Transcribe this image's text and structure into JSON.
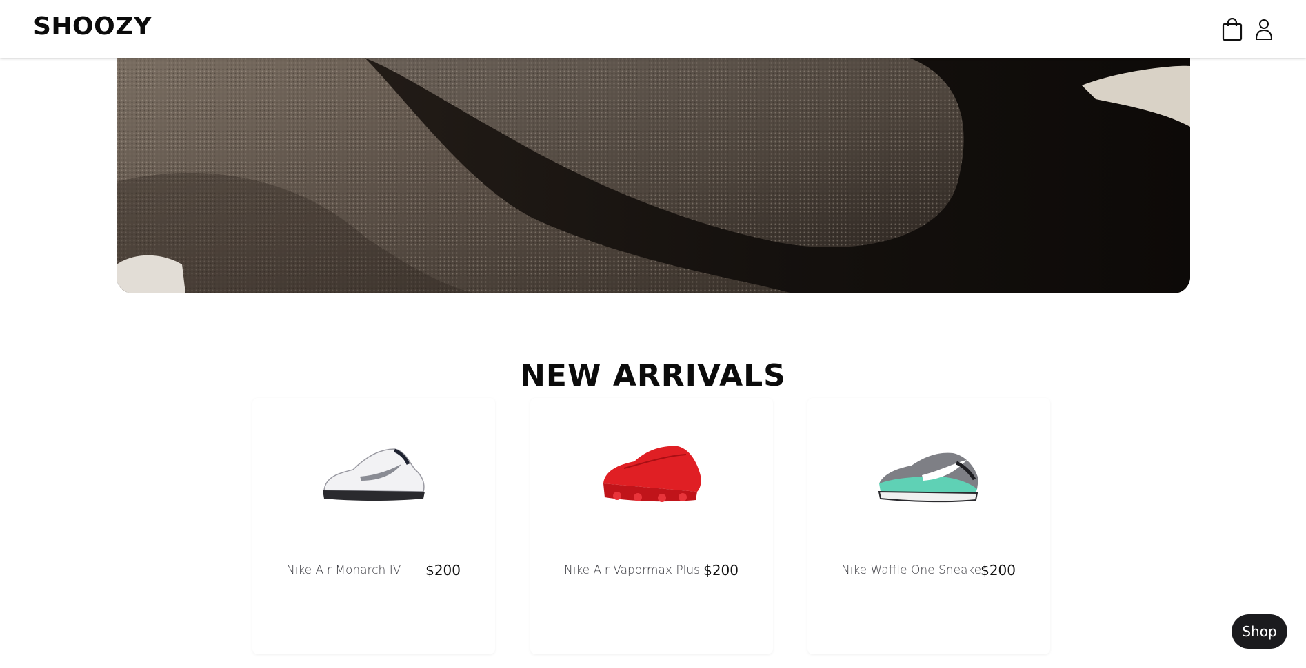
{
  "brand": {
    "logo_text": "SHOOZY"
  },
  "header": {
    "icons": [
      "shopping-bag-icon",
      "user-icon"
    ]
  },
  "hero": {
    "image": "knit-sneaker-closeup"
  },
  "new_arrivals": {
    "title": "NEW ARRIVALS",
    "products": [
      {
        "name": "Nike Air Monarch IV",
        "price": "$200",
        "image": "white-sneaker"
      },
      {
        "name": "Nike Air Vapormax Plus",
        "price": "$200",
        "image": "red-sneaker"
      },
      {
        "name": "Nike Waffle One Sneaker",
        "price": "$200",
        "image": "teal-grey-sneaker"
      }
    ]
  },
  "floating": {
    "shop_label": "Shop"
  },
  "colors": {
    "text_primary": "#0b0b0b",
    "button_bg": "#1b1b1e"
  }
}
